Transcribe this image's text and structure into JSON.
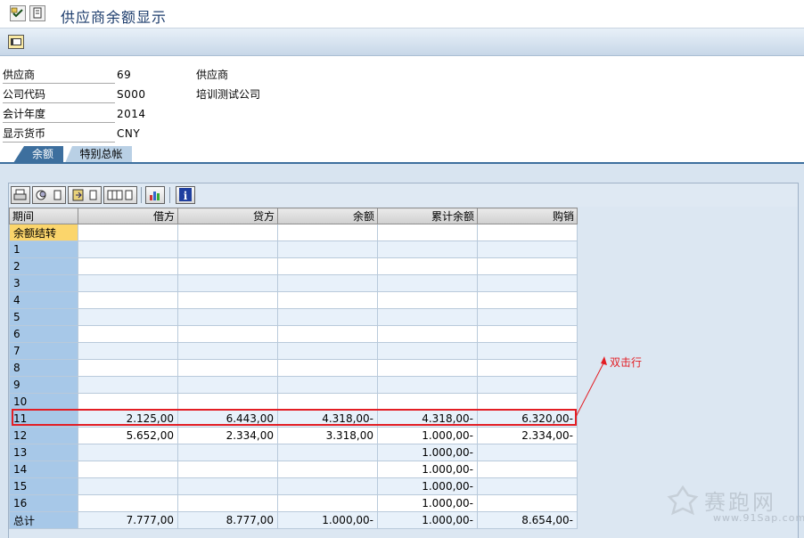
{
  "window": {
    "title": "供应商余额显示"
  },
  "header_fields": [
    {
      "label": "供应商",
      "value": "69",
      "desc": "供应商"
    },
    {
      "label": "公司代码",
      "value": "S000",
      "desc": "培训测试公司"
    },
    {
      "label": "会计年度",
      "value": "2014",
      "desc": ""
    },
    {
      "label": "显示货币",
      "value": "CNY",
      "desc": ""
    }
  ],
  "tabs": {
    "balance": "余额",
    "special_gl": "特别总帐"
  },
  "grid": {
    "columns": [
      "期间",
      "借方",
      "贷方",
      "余额",
      "累计余额",
      "购销"
    ],
    "rows": [
      [
        "余额结转",
        "",
        "",
        "",
        "",
        ""
      ],
      [
        "1",
        "",
        "",
        "",
        "",
        ""
      ],
      [
        "2",
        "",
        "",
        "",
        "",
        ""
      ],
      [
        "3",
        "",
        "",
        "",
        "",
        ""
      ],
      [
        "4",
        "",
        "",
        "",
        "",
        ""
      ],
      [
        "5",
        "",
        "",
        "",
        "",
        ""
      ],
      [
        "6",
        "",
        "",
        "",
        "",
        ""
      ],
      [
        "7",
        "",
        "",
        "",
        "",
        ""
      ],
      [
        "8",
        "",
        "",
        "",
        "",
        ""
      ],
      [
        "9",
        "",
        "",
        "",
        "",
        ""
      ],
      [
        "10",
        "",
        "",
        "",
        "",
        ""
      ],
      [
        "11",
        "2.125,00",
        "6.443,00",
        "4.318,00-",
        "4.318,00-",
        "6.320,00-"
      ],
      [
        "12",
        "5.652,00",
        "2.334,00",
        "3.318,00",
        "1.000,00-",
        "2.334,00-"
      ],
      [
        "13",
        "",
        "",
        "",
        "1.000,00-",
        ""
      ],
      [
        "14",
        "",
        "",
        "",
        "1.000,00-",
        ""
      ],
      [
        "15",
        "",
        "",
        "",
        "1.000,00-",
        ""
      ],
      [
        "16",
        "",
        "",
        "",
        "1.000,00-",
        ""
      ],
      [
        "总计",
        "7.777,00",
        "8.777,00",
        "1.000,00-",
        "1.000,00-",
        "8.654,00-"
      ]
    ]
  },
  "annotation": {
    "text": "双击行",
    "color": "#e31e24"
  },
  "watermark": {
    "brand": "赛跑网",
    "url": "www.91Sap.com"
  },
  "icons": [
    "check-icon",
    "print-icon",
    "detail-icon",
    "export-icon",
    "layout-icon",
    "chart-icon",
    "info-icon"
  ]
}
